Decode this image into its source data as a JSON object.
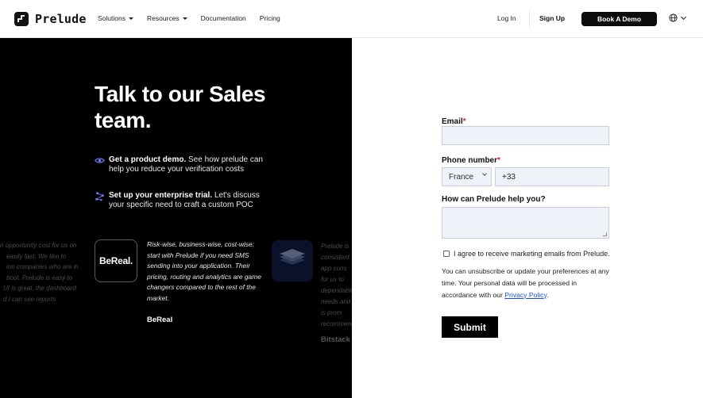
{
  "header": {
    "brand": "Prelude",
    "nav": [
      {
        "label": "Solutions",
        "has_caret": true
      },
      {
        "label": "Resources",
        "has_caret": true
      },
      {
        "label": "Documentation",
        "has_caret": false
      },
      {
        "label": "Pricing",
        "has_caret": false
      }
    ],
    "login_label": "Log In",
    "signup_label": "Sign Up",
    "book_demo_label": "Book A Demo",
    "language_icon": "globe-icon"
  },
  "hero": {
    "title": "Talk to our Sales team.",
    "features": [
      {
        "icon": "eye-icon",
        "bold": "Get a product demo.",
        "text": " See how prelude can help you reduce your verification costs"
      },
      {
        "icon": "nodes-icon",
        "bold": "Set up your enterprise trial.",
        "text": " Let's discuss your specific need to craft a custom POC"
      }
    ]
  },
  "testimonials": {
    "prev_fragments": [
      "n opportunity cost for us on",
      "easily fast. We like to",
      "ion companies who are in",
      "bool. Prelude is easy to",
      "UI is great, the dashboard",
      "d I can see reports"
    ],
    "current": {
      "logo_text": "BeReal.",
      "quote": "Risk-wise, business-wise, cost-wise: start with Prelude if you need SMS sending into your application. Their pricing, routing and analytics are game changers compared to the rest of the market.",
      "author": "BeReal"
    },
    "next_fragments": [
      "Prelude is",
      "consistent",
      "app cons",
      "for us to",
      "dependable",
      "needs and",
      "is prom",
      "recommend"
    ],
    "next_author": "Bitstack"
  },
  "form": {
    "email_label": "Email",
    "email_value": "",
    "phone_label": "Phone number",
    "country_value": "France",
    "phone_value": "+33",
    "help_label": "How can Prelude help you?",
    "help_value": "",
    "required_mark": "*",
    "consent_label": "I agree to receive marketing emails from Prelude.",
    "consent_checked": false,
    "privacy_text": "You can unsubscribe or update your preferences at any time. Your personal data will be processed in accordance with our ",
    "privacy_link": "Privacy Policy",
    "privacy_end": ".",
    "submit_label": "Submit"
  },
  "colors": {
    "dark_panel": "#000000",
    "required": "#e02424",
    "link": "#1d4ed8",
    "input_bg": "#eef2f9",
    "accent_icon": "#6f7cff"
  }
}
